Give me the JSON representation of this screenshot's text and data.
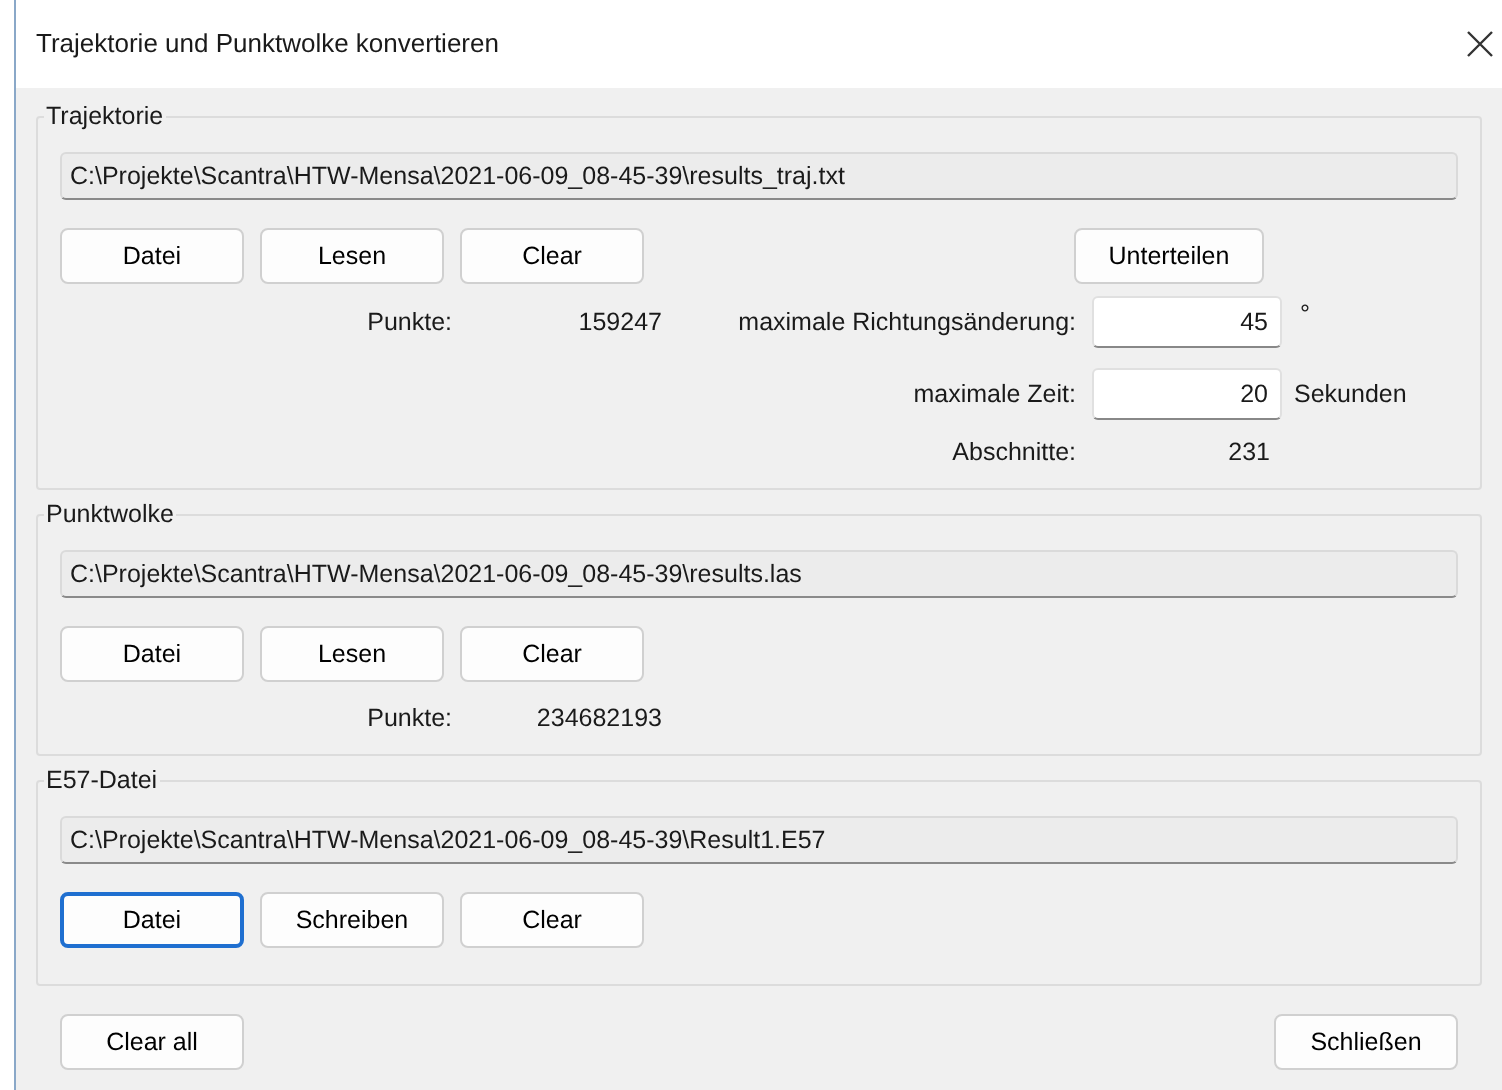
{
  "window": {
    "title": "Trajektorie und Punktwolke konvertieren"
  },
  "trajektorie": {
    "title": "Trajektorie",
    "path": "C:\\Projekte\\Scantra\\HTW-Mensa\\2021-06-09_08-45-39\\results_traj.txt",
    "buttons": [
      {
        "label": "Datei",
        "focused": false
      },
      {
        "label": "Lesen",
        "focused": false
      },
      {
        "label": "Clear",
        "focused": false
      }
    ],
    "split_button": {
      "label": "Unterteilen",
      "focused": false
    },
    "points_label": "Punkte:",
    "points_value": "159247",
    "angle_label": "maximale Richtungsänderung:",
    "angle_value": "45",
    "angle_unit": "°",
    "time_label": "maximale Zeit:",
    "time_value": "20",
    "time_unit": "Sekunden",
    "segments_label": "Abschnitte:",
    "segments_value": "231"
  },
  "punktwolke": {
    "title": "Punktwolke",
    "path": "C:\\Projekte\\Scantra\\HTW-Mensa\\2021-06-09_08-45-39\\results.las",
    "buttons": [
      {
        "label": "Datei",
        "focused": false
      },
      {
        "label": "Lesen",
        "focused": false
      },
      {
        "label": "Clear",
        "focused": false
      }
    ],
    "points_label": "Punkte:",
    "points_value": "234682193"
  },
  "e57": {
    "title": "E57-Datei",
    "path": "C:\\Projekte\\Scantra\\HTW-Mensa\\2021-06-09_08-45-39\\Result1.E57",
    "buttons": [
      {
        "label": "Datei",
        "focused": true
      },
      {
        "label": "Schreiben",
        "focused": false
      },
      {
        "label": "Clear",
        "focused": false
      }
    ]
  },
  "footer": {
    "buttons": [
      {
        "label": "Clear all",
        "focused": false
      },
      {
        "label": "Schließen",
        "focused": false
      }
    ]
  }
}
